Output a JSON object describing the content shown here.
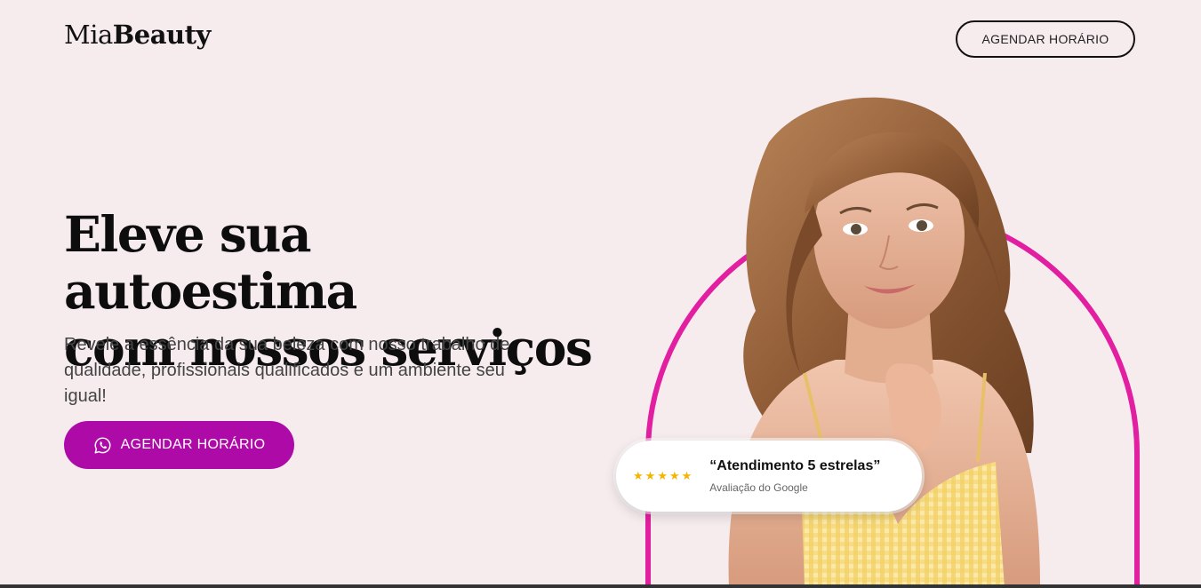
{
  "header": {
    "logo_light": "Mia",
    "logo_bold": "Beauty",
    "cta_label": "AGENDAR HORÁRIO"
  },
  "hero": {
    "title_line1": "Eleve sua autoestima",
    "title_line2": "com nossos serviços",
    "subtitle": "Revele a essência da sua beleza com nosso trabalho de qualidade, profissionais qualificados e um ambiente seu igual!",
    "cta_label": "AGENDAR HORÁRIO",
    "cta_icon": "whatsapp-icon"
  },
  "review": {
    "rating": 5,
    "quote": "“Atendimento 5 estrelas”",
    "source": "Avaliação do Google"
  },
  "colors": {
    "background": "#f6ecee",
    "accent": "#ae0aa8",
    "arch": "#e21fa0",
    "star": "#f4b400"
  }
}
